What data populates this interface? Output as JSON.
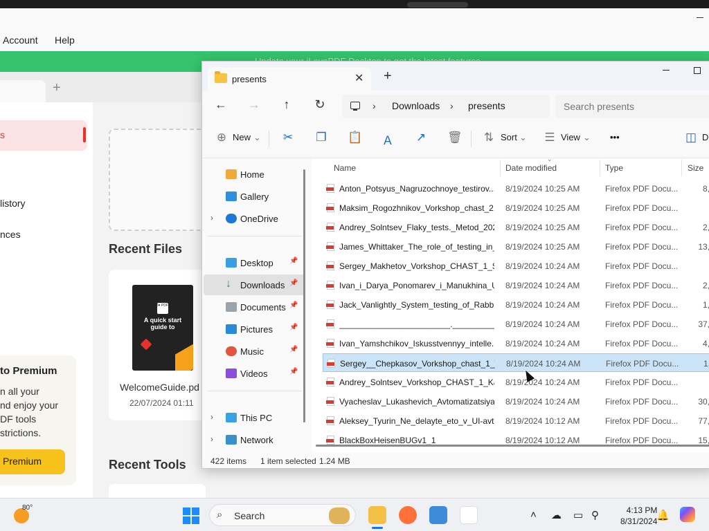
{
  "background_app": {
    "menu": [
      "Account",
      "Help"
    ],
    "banner_text": "Update your iLovePDF Desktop to get the latest features",
    "sidebar_active_label": "s",
    "sidebar_items": [
      "listory",
      "nces"
    ],
    "recent_files_title": "Recent Files",
    "file_card": {
      "name": "WelcomeGuide.pd",
      "date": "22/07/2024 01:11",
      "thumb_logo": "I♥ PDF",
      "thumb_title": "A quick start guide to"
    },
    "recent_tools_title": "Recent Tools",
    "premium": {
      "title": "to Premium",
      "lines": [
        "n all your",
        "nd enjoy your",
        "DF tools",
        "strictions."
      ],
      "button": "Premium"
    }
  },
  "explorer": {
    "tab_title": "presents",
    "tab_close": "✕",
    "new_tab": "+",
    "address": {
      "crumbs": [
        "Downloads",
        "presents"
      ]
    },
    "search_placeholder": "Search presents",
    "toolbar": {
      "new": "New",
      "sort": "Sort",
      "view": "View",
      "more": "•••",
      "details": "De"
    },
    "nav": {
      "home": "Home",
      "gallery": "Gallery",
      "onedrive": "OneDrive",
      "desktop": "Desktop",
      "downloads": "Downloads",
      "documents": "Documents",
      "pictures": "Pictures",
      "music": "Music",
      "videos": "Videos",
      "thispc": "This PC",
      "network": "Network"
    },
    "columns": {
      "name": "Name",
      "date": "Date modified",
      "type": "Type",
      "size": "Size"
    },
    "files": [
      {
        "name": "Anton_Potsyus_Nagruzochnoye_testirov...",
        "date": "8/19/2024 10:25 AM",
        "type": "Firefox PDF Docu...",
        "size": "8,"
      },
      {
        "name": "Maksim_Rogozhnikov_Vorkshop_chast_2...",
        "date": "8/19/2024 10:25 AM",
        "type": "Firefox PDF Docu...",
        "size": ""
      },
      {
        "name": "Andrey_Solntsev_Flaky_tests._Metod_202...",
        "date": "8/19/2024 10:25 AM",
        "type": "Firefox PDF Docu...",
        "size": "2,"
      },
      {
        "name": "James_Whittaker_The_role_of_testing_in_...",
        "date": "8/19/2024 10:25 AM",
        "type": "Firefox PDF Docu...",
        "size": "13,"
      },
      {
        "name": "Sergey_Makhetov_Vorkshop_CHAST_1_St...",
        "date": "8/19/2024 10:24 AM",
        "type": "Firefox PDF Docu...",
        "size": ""
      },
      {
        "name": "Ivan_i_Darya_Ponomarev_i_Manukhina_U...",
        "date": "8/19/2024 10:24 AM",
        "type": "Firefox PDF Docu...",
        "size": "2,"
      },
      {
        "name": "Jack_Vanlightly_System_testing_of_Rabbi...",
        "date": "8/19/2024 10:24 AM",
        "type": "Firefox PDF Docu...",
        "size": "1,"
      },
      {
        "name": "________________________.___________...",
        "date": "8/19/2024 10:24 AM",
        "type": "Firefox PDF Docu...",
        "size": "37,"
      },
      {
        "name": "Ivan_Yamshchikov_Iskusstvennyy_intelle...",
        "date": "8/19/2024 10:24 AM",
        "type": "Firefox PDF Docu...",
        "size": "4,"
      },
      {
        "name": "Sergey__Chepkasov_Vorkshop_chast_1_V...",
        "date": "8/19/2024 10:24 AM",
        "type": "Firefox PDF Docu...",
        "size": "1,",
        "selected": true
      },
      {
        "name": "Andrey_Solntsev_Vorkshop_CHAST_1_Ka...",
        "date": "8/19/2024 10:24 AM",
        "type": "Firefox PDF Docu...",
        "size": ""
      },
      {
        "name": "Vyacheslav_Lukashevich_Avtomatizatsiya...",
        "date": "8/19/2024 10:24 AM",
        "type": "Firefox PDF Docu...",
        "size": "30,"
      },
      {
        "name": "Aleksey_Tyurin_Ne_delayte_eto_v_UI-avt...",
        "date": "8/19/2024 10:12 AM",
        "type": "Firefox PDF Docu...",
        "size": "77,"
      },
      {
        "name": "BlackBoxHeisenBUGv1_1",
        "date": "8/19/2024 10:12 AM",
        "type": "Firefox PDF Docu...",
        "size": "15,"
      }
    ],
    "status": {
      "count": "422 items",
      "selection": "1 item selected",
      "size": "1.24 MB"
    }
  },
  "taskbar": {
    "weather_temp": "80°",
    "search_label": "Search",
    "time": "4:13 PM",
    "date": "8/31/2024"
  }
}
